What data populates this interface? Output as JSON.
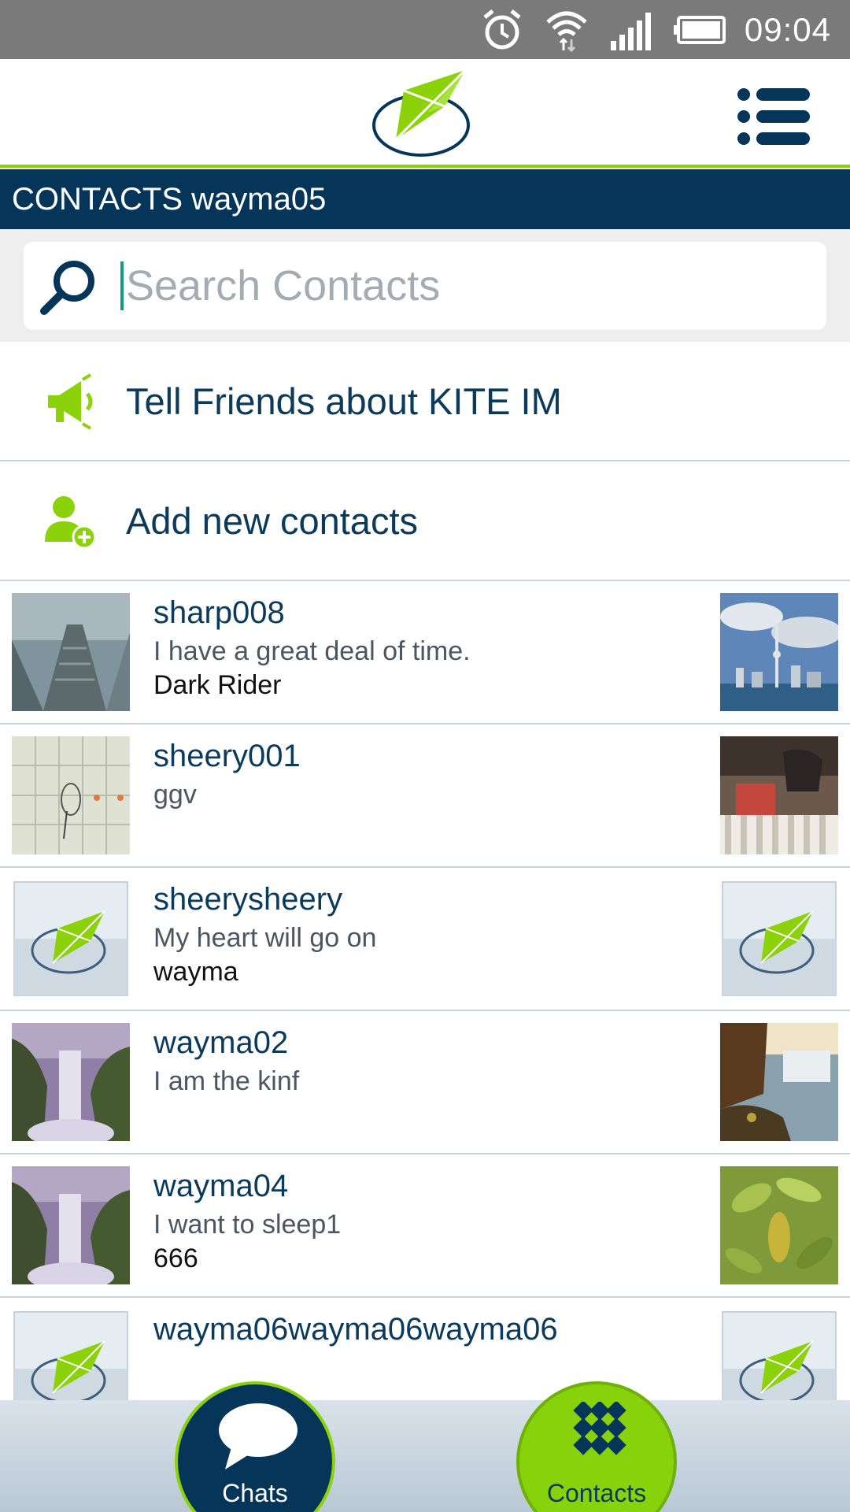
{
  "status_bar": {
    "time": "09:04",
    "icons": [
      "alarm-icon",
      "wifi-icon",
      "signal-icon",
      "battery-icon"
    ]
  },
  "header": {
    "logo": "kite-logo",
    "menu_icon": "list-menu-icon"
  },
  "title_bar": {
    "text": "CONTACTS wayma05"
  },
  "search": {
    "placeholder": "Search Contacts",
    "value": ""
  },
  "actions": [
    {
      "label": "Tell Friends about KITE IM",
      "icon": "megaphone-icon"
    },
    {
      "label": "Add new contacts",
      "icon": "add-user-icon"
    }
  ],
  "contacts": [
    {
      "name": "sharp008",
      "status": "I have a great deal of time.",
      "nickname": "Dark Rider"
    },
    {
      "name": "sheery001",
      "status": "ggv",
      "nickname": ""
    },
    {
      "name": "sheerysheery",
      "status": "My heart will go on",
      "nickname": "wayma"
    },
    {
      "name": "wayma02",
      "status": "I am the kinf",
      "nickname": ""
    },
    {
      "name": "wayma04",
      "status": "I want to sleep1",
      "nickname": "666"
    },
    {
      "name": "wayma06wayma06wayma06",
      "status": "",
      "nickname": ""
    }
  ],
  "bottom_nav": {
    "chats_label": "Chats",
    "contacts_label": "Contacts"
  },
  "colors": {
    "brand_navy": "#06355a",
    "brand_green": "#8bd20a",
    "status_bar": "#7a7a7a"
  }
}
